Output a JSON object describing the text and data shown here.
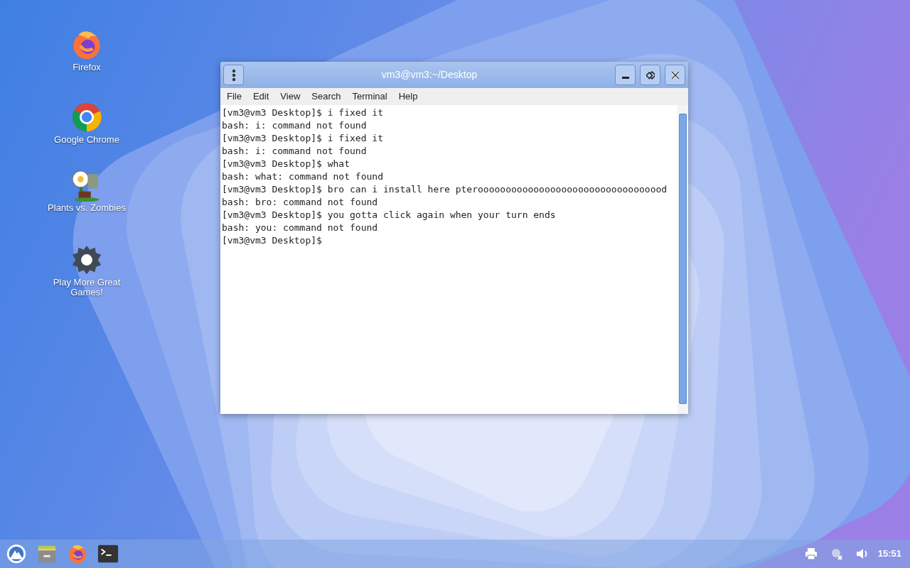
{
  "desktop_icons": [
    {
      "kind": "firefox",
      "label": "Firefox"
    },
    {
      "kind": "chrome",
      "label": "Google Chrome"
    },
    {
      "kind": "plants",
      "label": "Plants vs. Zombies"
    },
    {
      "kind": "gear",
      "label": "Play More Great Games!"
    }
  ],
  "window": {
    "title": "vm3@vm3:~/Desktop",
    "menu": [
      "File",
      "Edit",
      "View",
      "Search",
      "Terminal",
      "Help"
    ],
    "lines": [
      "[vm3@vm3 Desktop]$ i fixed it",
      "bash: i: command not found",
      "[vm3@vm3 Desktop]$ i fixed it",
      "bash: i: command not found",
      "[vm3@vm3 Desktop]$ what",
      "bash: what: command not found",
      "[vm3@vm3 Desktop]$ bro can i install here pteroooooooooooooooooooooooooooooooood",
      "bash: bro: command not found",
      "[vm3@vm3 Desktop]$ you gotta click again when your turn ends",
      "bash: you: command not found",
      "[vm3@vm3 Desktop]$"
    ]
  },
  "taskbar": {
    "apps": [
      {
        "kind": "launcher"
      },
      {
        "kind": "files"
      },
      {
        "kind": "firefox"
      },
      {
        "kind": "terminal"
      }
    ],
    "tray": [
      {
        "kind": "printer"
      },
      {
        "kind": "network"
      },
      {
        "kind": "volume"
      }
    ],
    "clock": "15:51"
  }
}
